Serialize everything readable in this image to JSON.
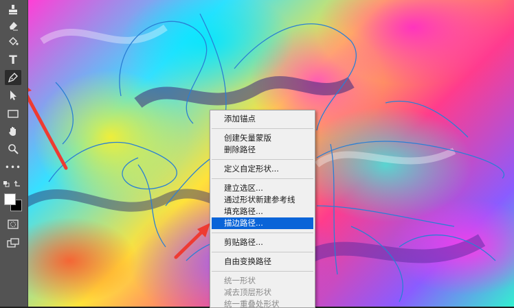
{
  "toolbar": {
    "tools": [
      {
        "name": "clone-stamp-tool",
        "glyph": "stamp"
      },
      {
        "name": "eraser-tool",
        "glyph": "eraser"
      },
      {
        "name": "paint-bucket-tool",
        "glyph": "bucket"
      },
      {
        "name": "type-tool",
        "glyph": "T"
      },
      {
        "name": "pen-tool",
        "glyph": "pen",
        "selected": true
      },
      {
        "name": "path-selection-tool",
        "glyph": "arrow"
      },
      {
        "name": "rectangle-tool",
        "glyph": "rect"
      },
      {
        "name": "hand-tool",
        "glyph": "hand"
      },
      {
        "name": "zoom-tool",
        "glyph": "zoom"
      },
      {
        "name": "more-tools",
        "glyph": "•••"
      }
    ],
    "foreground_color": "#ffffff",
    "background_color": "#000000"
  },
  "annotation": {
    "arrow_color": "#ee3b32"
  },
  "context_menu": {
    "groups": [
      [
        {
          "label": "添加锚点"
        }
      ],
      [
        {
          "label": "创建矢量蒙版"
        },
        {
          "label": "删除路径"
        }
      ],
      [
        {
          "label": "定义自定形状..."
        }
      ],
      [
        {
          "label": "建立选区..."
        },
        {
          "label": "通过形状新建参考线"
        },
        {
          "label": "填充路径..."
        },
        {
          "label": "描边路径...",
          "active": true
        }
      ],
      [
        {
          "label": "剪贴路径..."
        }
      ],
      [
        {
          "label": "自由变换路径"
        }
      ],
      [
        {
          "label": "统一形状",
          "disabled": true
        },
        {
          "label": "减去顶层形状",
          "disabled": true
        },
        {
          "label": "统一重叠处形状",
          "disabled": true
        }
      ]
    ]
  }
}
